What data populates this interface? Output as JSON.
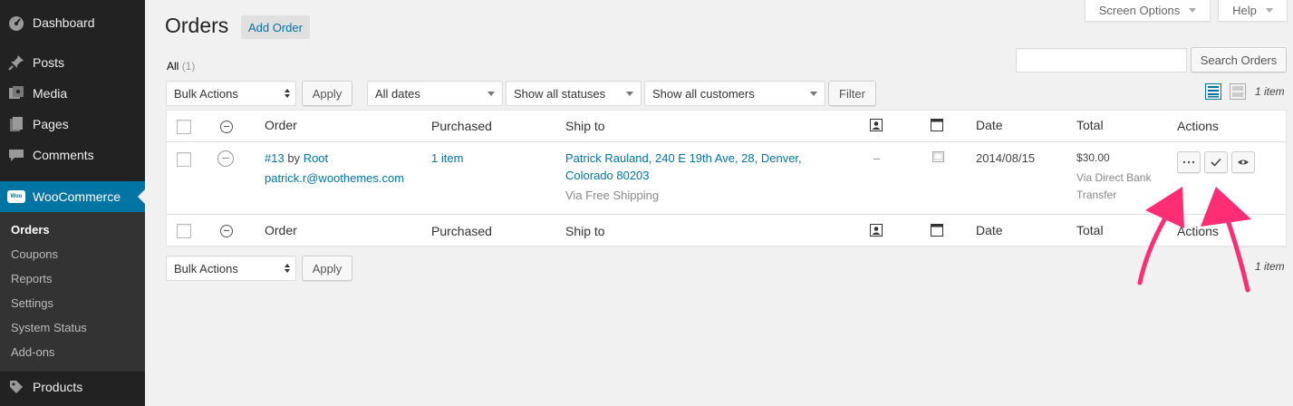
{
  "sidebar": {
    "items": [
      {
        "label": "Dashboard",
        "icon": "dashboard-icon"
      },
      {
        "label": "Posts",
        "icon": "pin-icon"
      },
      {
        "label": "Media",
        "icon": "media-icon"
      },
      {
        "label": "Pages",
        "icon": "pages-icon"
      },
      {
        "label": "Comments",
        "icon": "comments-icon"
      },
      {
        "label": "WooCommerce",
        "icon": "woocommerce-icon",
        "badge": "Woo"
      },
      {
        "label": "Products",
        "icon": "products-icon"
      }
    ],
    "submenu": [
      "Orders",
      "Coupons",
      "Reports",
      "Settings",
      "System Status",
      "Add-ons"
    ]
  },
  "top": {
    "screen_options": "Screen Options",
    "help": "Help"
  },
  "page": {
    "title": "Orders",
    "add_button": "Add Order"
  },
  "views": {
    "all_label": "All",
    "all_count": "(1)"
  },
  "search": {
    "value": "",
    "button": "Search Orders"
  },
  "filters": {
    "bulk_actions": "Bulk Actions",
    "apply": "Apply",
    "dates": "All dates",
    "statuses": "Show all statuses",
    "customers": "Show all customers",
    "filter": "Filter"
  },
  "item_count": "1 item",
  "table": {
    "columns": [
      "Order",
      "Purchased",
      "Ship to",
      "Date",
      "Total",
      "Actions"
    ],
    "rows": [
      {
        "order_number": "#13",
        "by": "by",
        "customer": "Root",
        "email": "patrick.r@woothemes.com",
        "purchased": "1 item",
        "ship_to_line1": "Patrick Rauland, 240 E 19th Ave, 28, Denver,",
        "ship_to_line2": "Colorado 80203",
        "shipping_method": "Via Free Shipping",
        "customer_note": "–",
        "date": "2014/08/15",
        "total": "$30.00",
        "payment_line1": "Via Direct Bank",
        "payment_line2": "Transfer"
      }
    ]
  },
  "colors": {
    "accent": "#0074a2",
    "sidebar": "#222222",
    "arrow": "#ff2d74"
  }
}
